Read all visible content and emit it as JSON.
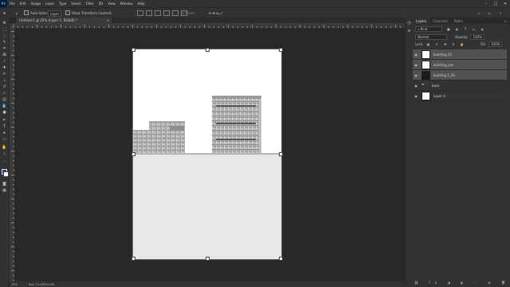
{
  "menubar": {
    "logo": "Ps",
    "items": [
      "File",
      "Edit",
      "Image",
      "Layer",
      "Type",
      "Select",
      "Filter",
      "3D",
      "View",
      "Window",
      "Help"
    ],
    "window_controls": [
      "–",
      "□",
      "✕"
    ]
  },
  "options": {
    "auto_select_label": "Auto-Select:",
    "auto_select_value": "Layer",
    "transform_label": "Show Transform Controls",
    "mode_label": "3D Mode:"
  },
  "document": {
    "tab_label": "Untitled-1 @ 25% (Layer 1, RGB/8) *",
    "status_zoom": "25%",
    "status_info": "Doc: 11.4M/24.0M"
  },
  "toolbar": {
    "tools": [
      "move-tool",
      "marquee-tool",
      "lasso-tool",
      "quick-select-tool",
      "crop-tool",
      "eyedropper-tool",
      "healing-tool",
      "brush-tool",
      "stamp-tool",
      "history-brush-tool",
      "eraser-tool",
      "gradient-tool",
      "blur-tool",
      "dodge-tool",
      "pen-tool",
      "type-tool",
      "path-select-tool",
      "shape-tool",
      "hand-tool",
      "zoom-tool",
      "more-tools",
      "colors",
      "mask-mode",
      "screen-mode"
    ]
  },
  "panel": {
    "tabs": [
      "Layers",
      "Channels",
      "Paths"
    ],
    "filter_label": "Kind",
    "blend_mode": "Normal",
    "opacity_label": "Opacity:",
    "opacity_value": "100%",
    "lock_label": "Lock:",
    "fill_label": "Fill:",
    "fill_value": "100%",
    "layers": [
      {
        "name": "building_01",
        "thumb": "white",
        "selected": true
      },
      {
        "name": "building_one",
        "thumb": "white",
        "selected": true
      },
      {
        "name": "building 1_02",
        "thumb": "dark",
        "selected": true
      },
      {
        "name": "back",
        "thumb": "folder",
        "selected": false
      },
      {
        "name": "Layer 0",
        "thumb": "white",
        "selected": false
      }
    ]
  },
  "colors": {
    "bg": "#282828",
    "chrome": "#323232",
    "accent": "#31a8ff",
    "selection": "#525252"
  }
}
